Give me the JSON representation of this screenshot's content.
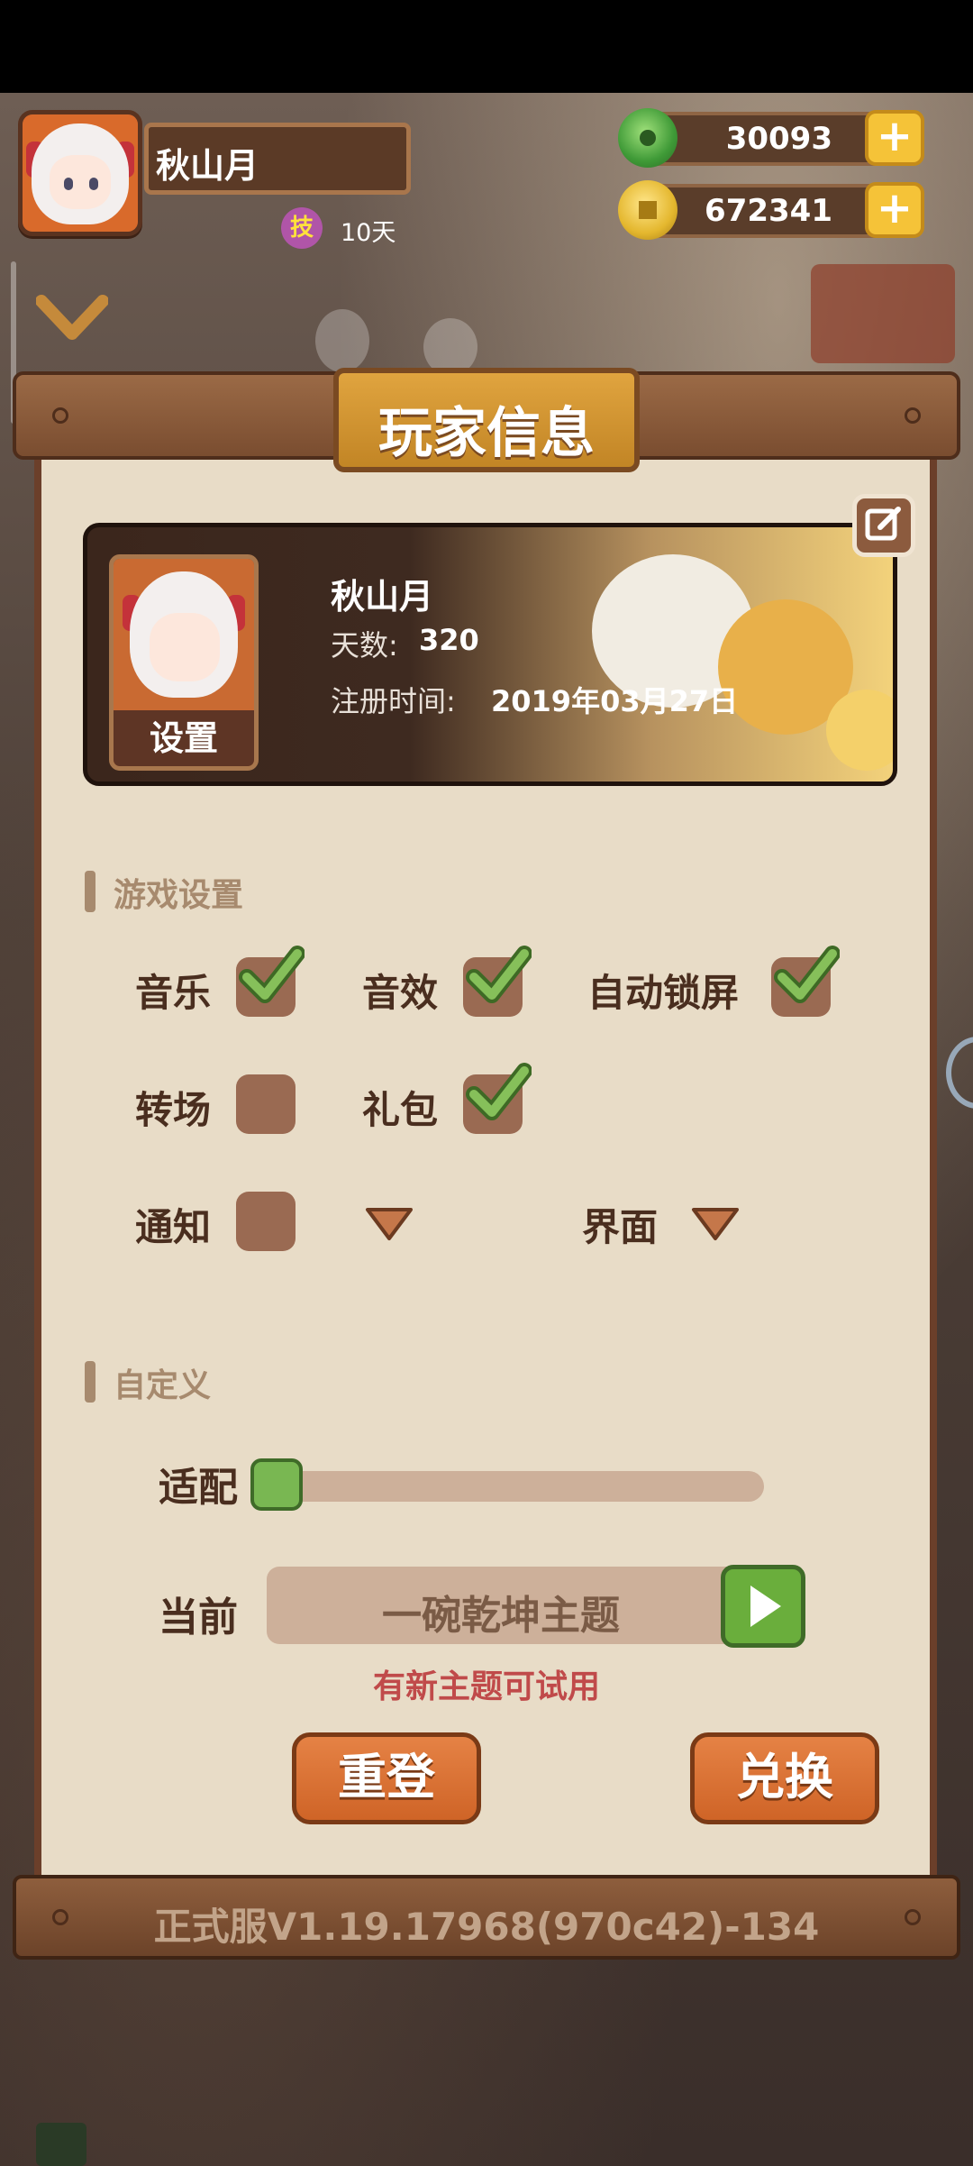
{
  "hud": {
    "player_name": "秋山月",
    "skill_badge": "技",
    "skill_days": "10天",
    "jade": {
      "value": "30093",
      "icon": "jade-icon"
    },
    "gold": {
      "value": "672341",
      "icon": "gold-coin-icon"
    }
  },
  "panel": {
    "title": "玩家信息"
  },
  "profile": {
    "name": "秋山月",
    "days_label": "天数:",
    "days": "320",
    "registered_label": "注册时间:",
    "registered": "2019年03月27日",
    "settings_button": "设置"
  },
  "game_settings": {
    "section_title": "游戏设置",
    "options": [
      {
        "label": "音乐",
        "checked": true
      },
      {
        "label": "音效",
        "checked": true
      },
      {
        "label": "自动锁屏",
        "checked": true
      },
      {
        "label": "转场",
        "checked": false
      },
      {
        "label": "礼包",
        "checked": true
      },
      {
        "label": "通知",
        "checked": false
      },
      {
        "label": "界面",
        "dropdown": true
      }
    ]
  },
  "custom": {
    "section_title": "自定义",
    "adapt_label": "适配",
    "adapt_level": 0,
    "current_label": "当前",
    "theme_name": "一碗乾坤主题",
    "theme_hint": "有新主题可试用"
  },
  "buttons": {
    "relogin": "重登",
    "redeem": "兑换"
  },
  "footer": {
    "version": "正式服V1.19.17968(970c42)-134"
  },
  "colors": {
    "accent_green": "#6aae3c",
    "button_orange": "#dd7436",
    "title_gold": "#d89a34",
    "panel_bg": "#e8dcc7",
    "hint_red": "#c04a4a"
  }
}
